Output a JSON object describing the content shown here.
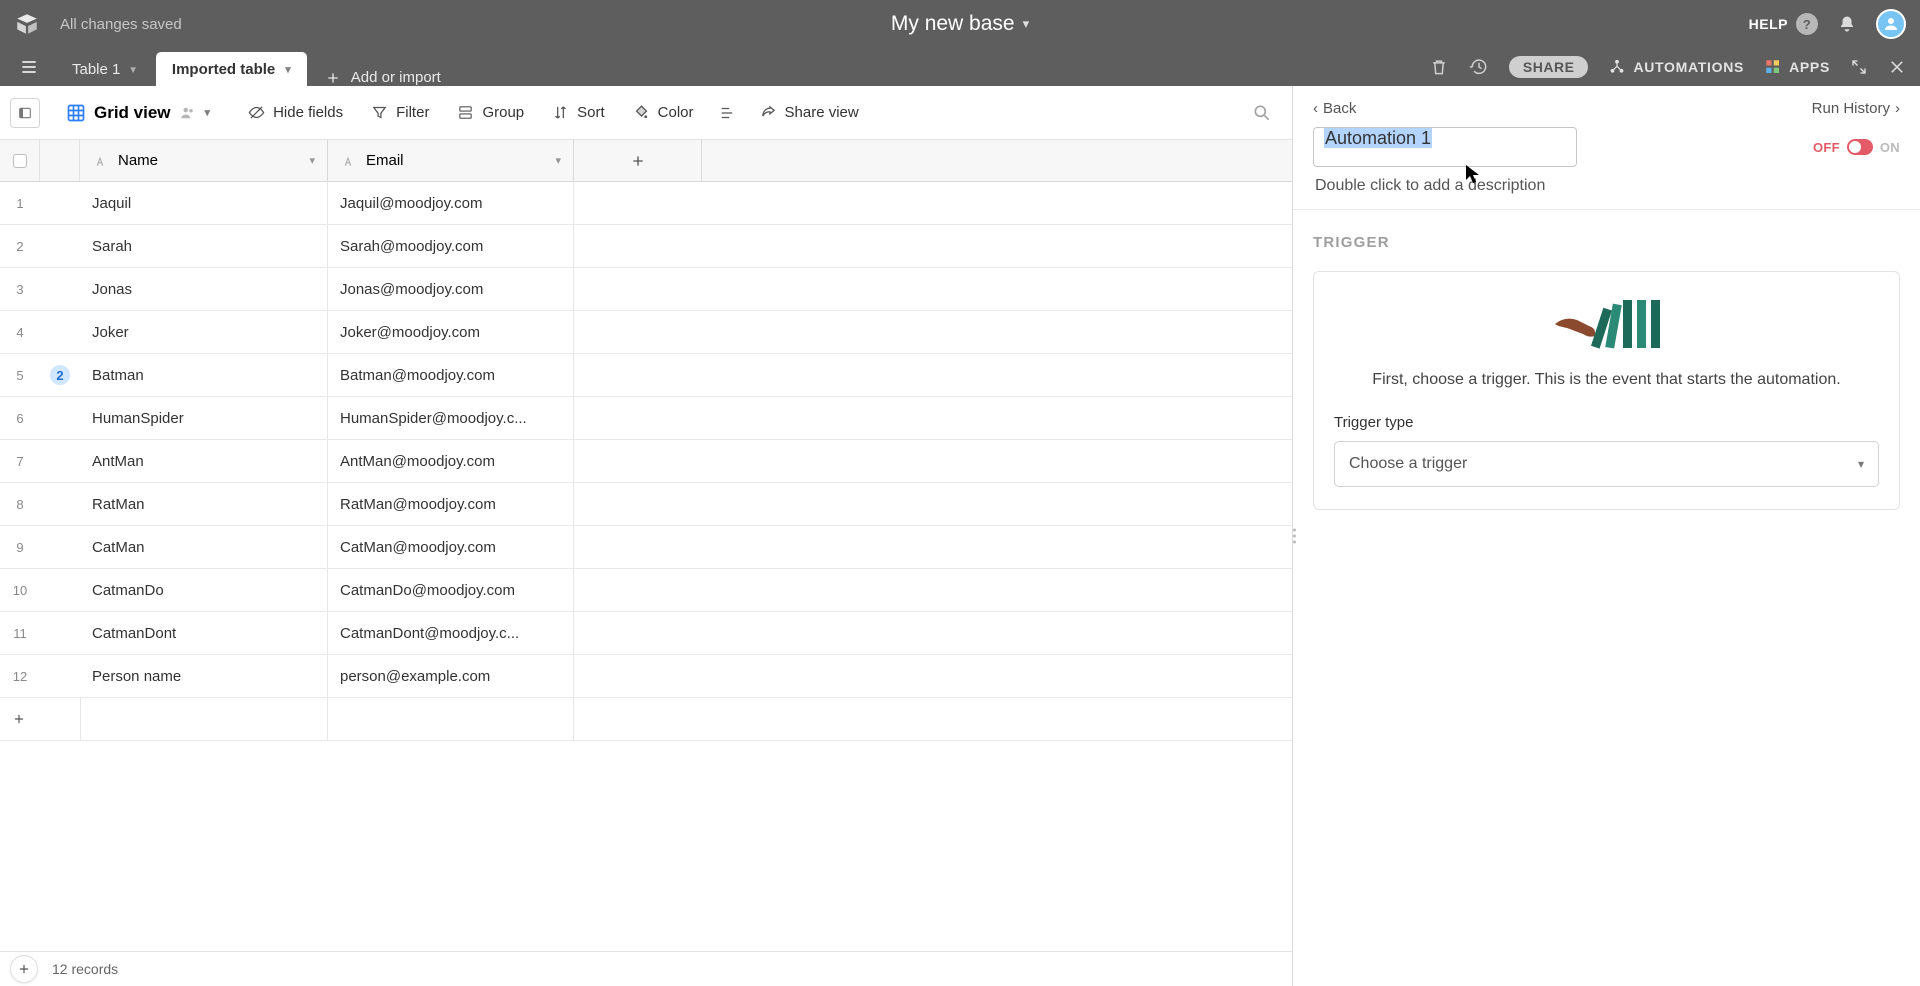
{
  "header": {
    "saved_text": "All changes saved",
    "title": "My new base",
    "help_label": "HELP"
  },
  "tabs": {
    "tab1_label": "Table 1",
    "tab2_label": "Imported table",
    "add_label": "Add or import"
  },
  "tabs_right": {
    "share_label": "SHARE",
    "automations_label": "AUTOMATIONS",
    "apps_label": "APPS"
  },
  "toolbar": {
    "view_label": "Grid view",
    "hide_fields": "Hide fields",
    "filter": "Filter",
    "group": "Group",
    "sort": "Sort",
    "color": "Color",
    "share_view": "Share view"
  },
  "columns": {
    "a": "Name",
    "b": "Email"
  },
  "rows": [
    {
      "n": "1",
      "name": "Jaquil",
      "email": "Jaquil@moodjoy.com",
      "badge": ""
    },
    {
      "n": "2",
      "name": "Sarah",
      "email": "Sarah@moodjoy.com",
      "badge": ""
    },
    {
      "n": "3",
      "name": "Jonas",
      "email": "Jonas@moodjoy.com",
      "badge": ""
    },
    {
      "n": "4",
      "name": "Joker",
      "email": "Joker@moodjoy.com",
      "badge": ""
    },
    {
      "n": "5",
      "name": "Batman",
      "email": "Batman@moodjoy.com",
      "badge": "2"
    },
    {
      "n": "6",
      "name": "HumanSpider",
      "email": "HumanSpider@moodjoy.c...",
      "badge": ""
    },
    {
      "n": "7",
      "name": "AntMan",
      "email": "AntMan@moodjoy.com",
      "badge": ""
    },
    {
      "n": "8",
      "name": "RatMan",
      "email": "RatMan@moodjoy.com",
      "badge": ""
    },
    {
      "n": "9",
      "name": "CatMan",
      "email": "CatMan@moodjoy.com",
      "badge": ""
    },
    {
      "n": "10",
      "name": "CatmanDo",
      "email": "CatmanDo@moodjoy.com",
      "badge": ""
    },
    {
      "n": "11",
      "name": "CatmanDont",
      "email": "CatmanDont@moodjoy.c...",
      "badge": ""
    },
    {
      "n": "12",
      "name": "Person name",
      "email": "person@example.com",
      "badge": ""
    }
  ],
  "footer": {
    "records_label": "12 records"
  },
  "automation": {
    "back_label": "Back",
    "run_history_label": "Run History",
    "name": "Automation 1",
    "off_label": "OFF",
    "on_label": "ON",
    "description_hint": "Double click to add a description",
    "trigger_section": "TRIGGER",
    "trigger_intro": "First, choose a trigger. This is the event that starts the automation.",
    "trigger_type_label": "Trigger type",
    "trigger_select_placeholder": "Choose a trigger"
  }
}
